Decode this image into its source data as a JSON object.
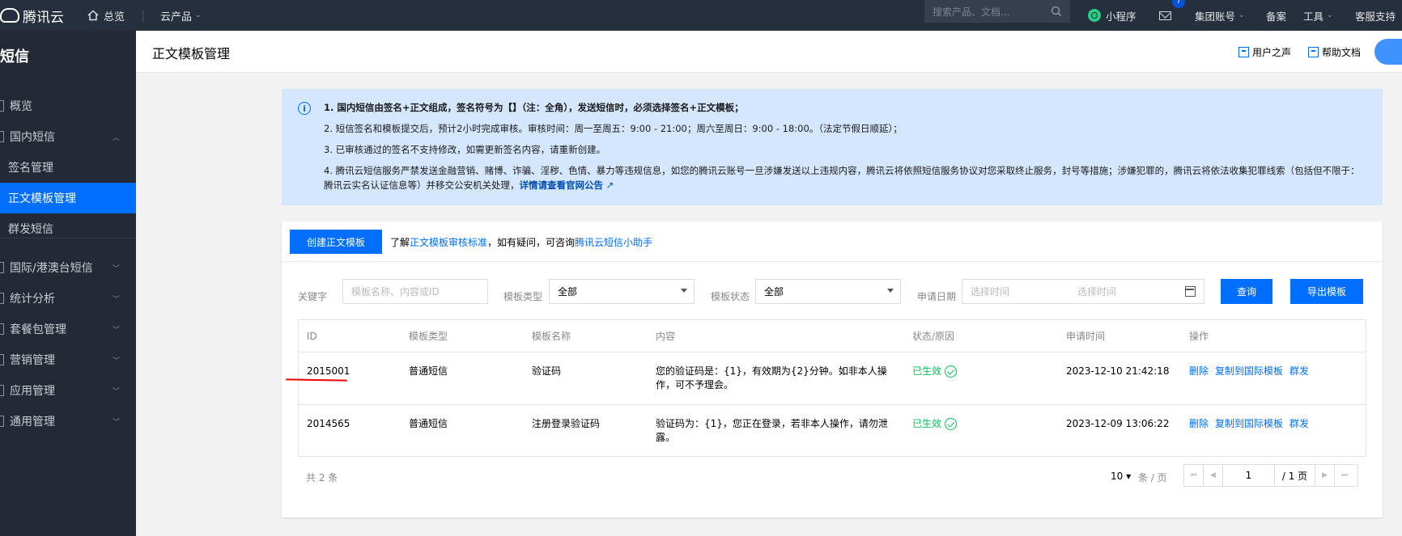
{
  "topbar": {
    "brand": "腾讯云",
    "home": "总览",
    "products": "云产品",
    "search_placeholder": "搜索产品、文档...",
    "miniprogram": "小程序",
    "badge": "7",
    "group_account": "集团账号",
    "filing": "备案",
    "tools": "工具",
    "support": "客服支持"
  },
  "sidebar": {
    "title": "短信",
    "items": [
      {
        "label": "概览"
      },
      {
        "label": "国内短信"
      },
      {
        "label": "签名管理"
      },
      {
        "label": "正文模板管理"
      },
      {
        "label": "群发短信"
      },
      {
        "label": "国际/港澳台短信"
      },
      {
        "label": "统计分析"
      },
      {
        "label": "套餐包管理"
      },
      {
        "label": "营销管理"
      },
      {
        "label": "应用管理"
      },
      {
        "label": "通用管理"
      }
    ]
  },
  "header": {
    "title": "正文模板管理",
    "user_voice": "用户之声",
    "help_docs": "帮助文档"
  },
  "notice": {
    "line1": "1. 国内短信由签名+正文组成，签名符号为【】（注：全角），发送短信时，必须选择签名+正文模板；",
    "line2": "2. 短信签名和模板提交后，预计2小时完成审核。审核时间：周一至周五：9:00 - 21:00；周六至周日：9:00 - 18:00。（法定节假日顺延）；",
    "line3": "3. 已审核通过的签名不支持修改，如需更新签名内容，请重新创建。",
    "line4": "4. 腾讯云短信服务严禁发送金融营销、赌博、诈骗、淫秽、色情、暴力等违规信息，如您的腾讯云账号一旦涉嫌发送以上违规内容，腾讯云将依照短信服务协议对您采取终止服务，封号等措施；涉嫌犯罪的，腾讯云将依法收集犯罪线索（包括但不限于：腾讯云实名认证信息等）并移交公安机关处理，",
    "line4_link": "详情请查看官网公告"
  },
  "toolbar": {
    "create": "创建正文模板",
    "intro_prefix": "了解",
    "intro_link1": "正文模板审核标准",
    "intro_mid": "，如有疑问，可咨询",
    "intro_link2": "腾讯云短信小助手"
  },
  "filters": {
    "keyword_label": "关键字",
    "keyword_placeholder": "模板名称、内容或ID",
    "type_label": "模板类型",
    "type_value": "全部",
    "status_label": "模板状态",
    "status_value": "全部",
    "date_label": "申请日期",
    "date_start": "选择时间",
    "date_end": "选择时间",
    "query": "查询",
    "export": "导出模板"
  },
  "table": {
    "headers": [
      "ID",
      "模板类型",
      "模板名称",
      "内容",
      "状态/原因",
      "申请时间",
      "操作"
    ],
    "rows": [
      {
        "id": "2015001",
        "type": "普通短信",
        "name": "验证码",
        "content": "您的验证码是：{1}，有效期为{2}分钟。如非本人操作，可不予理会。",
        "status": "已生效",
        "time": "2023-12-10 21:42:18",
        "ops": [
          "删除",
          "复制到国际模板",
          "群发"
        ]
      },
      {
        "id": "2014565",
        "type": "普通短信",
        "name": "注册登录验证码",
        "content": "验证码为：{1}，您正在登录，若非本人操作，请勿泄露。",
        "status": "已生效",
        "time": "2023-12-09 13:06:22",
        "ops": [
          "删除",
          "复制到国际模板",
          "群发"
        ]
      }
    ]
  },
  "pagination": {
    "total": "共 2 条",
    "page_size": "10",
    "unit": "条 / 页",
    "current": "1",
    "total_pages": "/ 1 页"
  }
}
